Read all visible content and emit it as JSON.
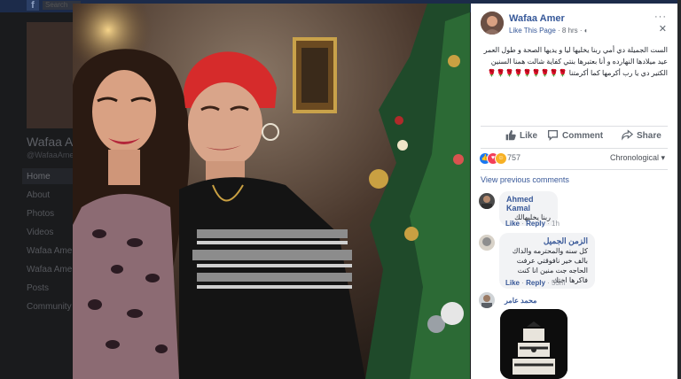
{
  "background_page": {
    "search_text": "Search",
    "page_name": "Wafaa Amer",
    "page_handle": "@WafaaAmer",
    "nav_items": [
      "Home",
      "About",
      "Photos",
      "Videos",
      "Wafaa Amer",
      "Wafaa Amer",
      "Posts",
      "Community"
    ]
  },
  "post": {
    "author": "Wafaa Amer",
    "like_page": "Like This Page",
    "time": " · 8 hrs · ",
    "body": "الست الجميلة دي أمي ربنا يخليها ليا و يديها الصحة و طول العمر عيد ميلادها النهارده و أنا بعتبرها بنتي كفاية شالت همنا السنين الكتير دي يا رب أكرمها كما أكرمتنا 🌹🌹🌹🌹🌹🌹🌹🌹🌹",
    "more_icon": "···",
    "close_icon": "✕"
  },
  "actions": {
    "like": "Like",
    "comment": "Comment",
    "share": "Share"
  },
  "reactions": {
    "count": "757",
    "sort": "Chronological ▾",
    "colors": {
      "like": "#1877f2",
      "love": "#f33e58",
      "haha": "#f7b125"
    }
  },
  "comments_section": {
    "view_previous": "View previous comments",
    "comments": [
      {
        "name": "Ahmed Kamal",
        "text": "ربنا يخليهالك",
        "like": "Like",
        "reply": "Reply",
        "time": "1h"
      },
      {
        "name": "الزمن الجميل",
        "text": "كل سنه والمحترمه والداك بالف خير نافوقتي عرفت الحاجه جت منين انا كنت فاكرها اختك",
        "like": "Like",
        "reply": "Reply",
        "time": "55m"
      },
      {
        "name": "محمد عامر",
        "text": "",
        "like": "",
        "reply": "",
        "time": ""
      }
    ]
  },
  "colors": {
    "link_blue": "#385898",
    "panel_bg": "#ffffff",
    "overlay_bg": "#000000"
  }
}
